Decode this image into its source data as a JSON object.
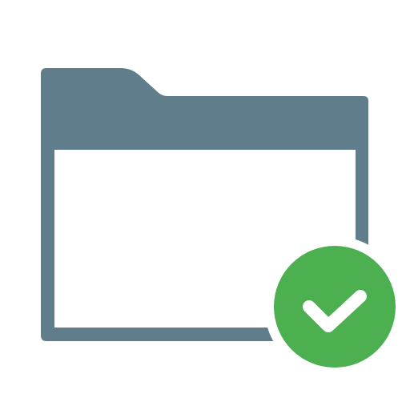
{
  "icon": {
    "name": "folder-check-icon",
    "colors": {
      "background": "#ffffff",
      "folder": "#607d8b",
      "folder_inner": "#ffffff",
      "badge": "#4caf50",
      "check": "#ffffff"
    }
  }
}
